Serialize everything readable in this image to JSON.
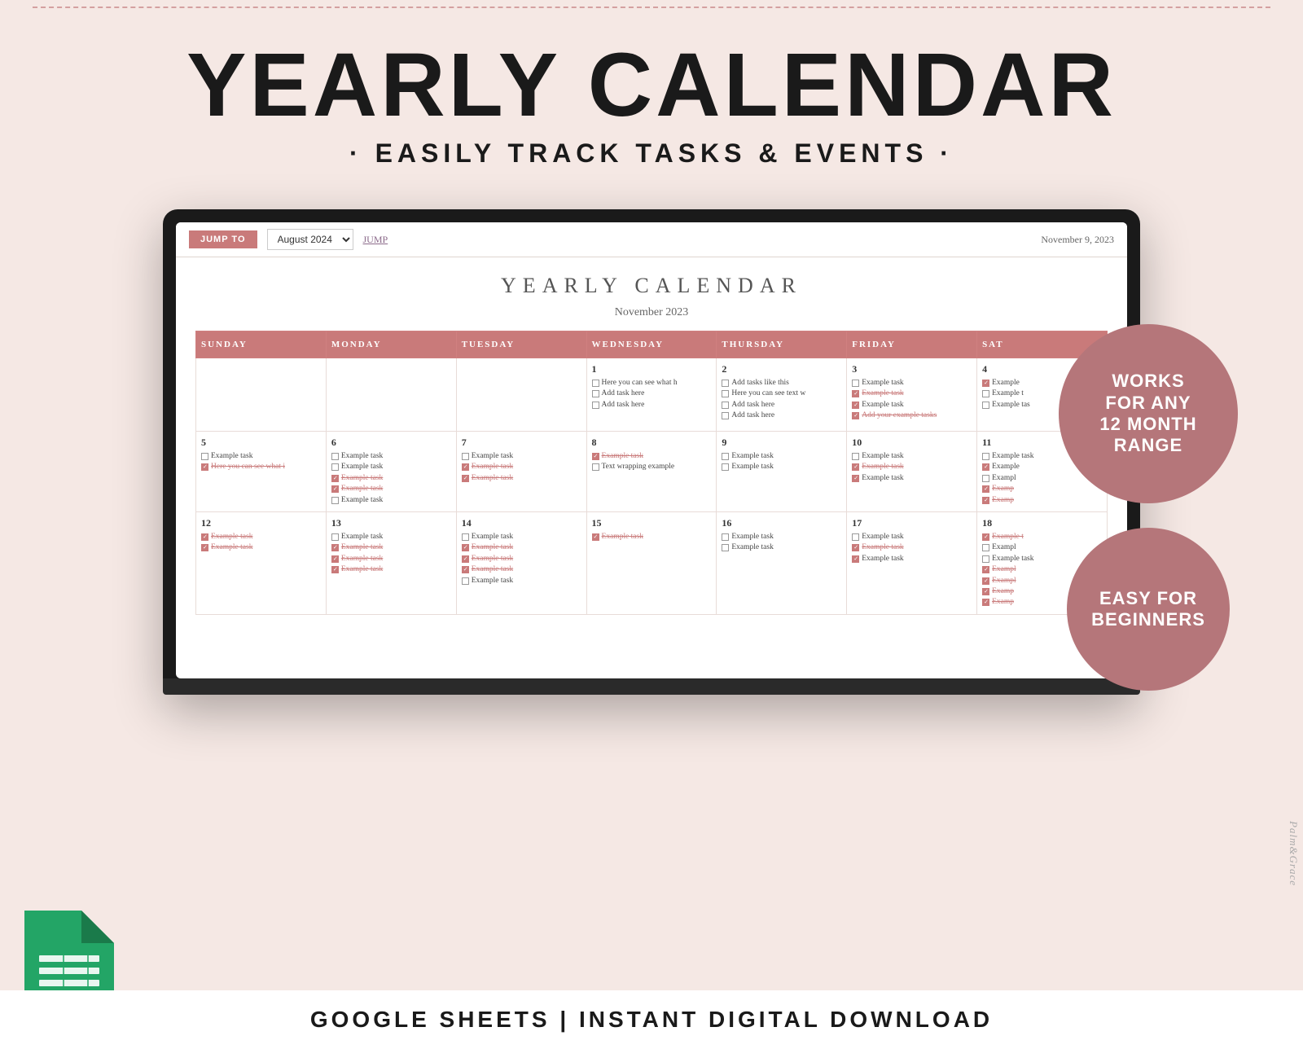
{
  "header": {
    "main_title": "YEARLY CALENDAR",
    "subtitle": "· EASILY TRACK TASKS & EVENTS ·"
  },
  "toolbar": {
    "jump_to_label": "JUMP TO",
    "month_value": "August 2024",
    "jump_link": "JUMP",
    "date_display": "November 9, 2023"
  },
  "calendar": {
    "title": "YEARLY CALENDAR",
    "month": "November 2023",
    "days": [
      "SUNDAY",
      "MONDAY",
      "TUESDAY",
      "WEDNESDAY",
      "THURSDAY",
      "FRIDAY",
      "SAT"
    ],
    "weeks": [
      {
        "cells": [
          {
            "day": "",
            "tasks": [],
            "empty": true
          },
          {
            "day": "",
            "tasks": [],
            "empty": true
          },
          {
            "day": "",
            "tasks": [],
            "empty": true
          },
          {
            "day": "1",
            "tasks": [
              {
                "text": "Here you can see what h",
                "checked": false,
                "strike": false
              },
              {
                "text": "Add task here",
                "checked": false,
                "strike": false
              },
              {
                "text": "Add task here",
                "checked": false,
                "strike": false
              }
            ]
          },
          {
            "day": "2",
            "tasks": [
              {
                "text": "Add tasks like this",
                "checked": false,
                "strike": false
              },
              {
                "text": "Here you can see text w",
                "checked": false,
                "strike": false
              },
              {
                "text": "Add task here",
                "checked": false,
                "strike": false
              },
              {
                "text": "Add task here",
                "checked": false,
                "strike": false
              }
            ]
          },
          {
            "day": "3",
            "tasks": [
              {
                "text": "Example task",
                "checked": false,
                "strike": false
              },
              {
                "text": "Example task",
                "checked": true,
                "strike": true
              },
              {
                "text": "Example task",
                "checked": true,
                "strike": false
              },
              {
                "text": "Add your example tasks",
                "checked": true,
                "strike": true
              }
            ]
          },
          {
            "day": "4",
            "tasks": [
              {
                "text": "Example",
                "checked": true,
                "strike": false
              },
              {
                "text": "Example t",
                "checked": false,
                "strike": false
              },
              {
                "text": "Example tas",
                "checked": false,
                "strike": false
              }
            ]
          }
        ]
      },
      {
        "cells": [
          {
            "day": "5",
            "tasks": [
              {
                "text": "Example task",
                "checked": false,
                "strike": false
              },
              {
                "text": "Here you can see what i",
                "checked": true,
                "strike": true
              }
            ]
          },
          {
            "day": "6",
            "tasks": [
              {
                "text": "Example task",
                "checked": false,
                "strike": false
              },
              {
                "text": "Example task",
                "checked": false,
                "strike": false
              },
              {
                "text": "Example task",
                "checked": true,
                "strike": true
              },
              {
                "text": "Example task",
                "checked": true,
                "strike": true
              },
              {
                "text": "Example task",
                "checked": false,
                "strike": false
              }
            ]
          },
          {
            "day": "7",
            "tasks": [
              {
                "text": "Example task",
                "checked": false,
                "strike": false
              },
              {
                "text": "Example task",
                "checked": true,
                "strike": true
              },
              {
                "text": "Example task",
                "checked": true,
                "strike": true
              }
            ]
          },
          {
            "day": "8",
            "tasks": [
              {
                "text": "Example task",
                "checked": true,
                "strike": true
              },
              {
                "text": "Text wrapping example",
                "checked": false,
                "strike": false
              }
            ]
          },
          {
            "day": "9",
            "tasks": [
              {
                "text": "Example task",
                "checked": false,
                "strike": false
              },
              {
                "text": "Example task",
                "checked": false,
                "strike": false
              }
            ]
          },
          {
            "day": "10",
            "tasks": [
              {
                "text": "Example task",
                "checked": false,
                "strike": false
              },
              {
                "text": "Example task",
                "checked": true,
                "strike": true
              },
              {
                "text": "Example task",
                "checked": true,
                "strike": false
              }
            ]
          },
          {
            "day": "11",
            "tasks": [
              {
                "text": "Example task",
                "checked": false,
                "strike": false
              },
              {
                "text": "Example",
                "checked": true,
                "strike": false
              },
              {
                "text": "Exampl",
                "checked": false,
                "strike": false
              },
              {
                "text": "Examp",
                "checked": true,
                "strike": true
              },
              {
                "text": "Examp",
                "checked": true,
                "strike": true
              }
            ]
          }
        ]
      },
      {
        "cells": [
          {
            "day": "12",
            "tasks": [
              {
                "text": "Example task",
                "checked": true,
                "strike": true
              },
              {
                "text": "Example task",
                "checked": true,
                "strike": true
              }
            ]
          },
          {
            "day": "13",
            "tasks": [
              {
                "text": "Example task",
                "checked": false,
                "strike": false
              },
              {
                "text": "Example task",
                "checked": true,
                "strike": true
              },
              {
                "text": "Example task",
                "checked": true,
                "strike": true
              },
              {
                "text": "Example task",
                "checked": true,
                "strike": true
              }
            ]
          },
          {
            "day": "14",
            "tasks": [
              {
                "text": "Example task",
                "checked": false,
                "strike": false
              },
              {
                "text": "Example task",
                "checked": true,
                "strike": true
              },
              {
                "text": "Example task",
                "checked": true,
                "strike": true
              },
              {
                "text": "Example task",
                "checked": true,
                "strike": true
              },
              {
                "text": "Example task",
                "checked": false,
                "strike": false
              }
            ]
          },
          {
            "day": "15",
            "tasks": [
              {
                "text": "Example task",
                "checked": true,
                "strike": true
              }
            ]
          },
          {
            "day": "16",
            "tasks": [
              {
                "text": "Example task",
                "checked": false,
                "strike": false
              },
              {
                "text": "Example task",
                "checked": false,
                "strike": false
              }
            ]
          },
          {
            "day": "17",
            "tasks": [
              {
                "text": "Example task",
                "checked": false,
                "strike": false
              },
              {
                "text": "Example task",
                "checked": true,
                "strike": true
              },
              {
                "text": "Example task",
                "checked": true,
                "strike": false
              }
            ]
          },
          {
            "day": "18",
            "tasks": [
              {
                "text": "Example t",
                "checked": true,
                "strike": true
              },
              {
                "text": "Exampl",
                "checked": false,
                "strike": false
              },
              {
                "text": "Example task",
                "checked": false,
                "strike": false
              },
              {
                "text": "Exampl",
                "checked": true,
                "strike": true
              },
              {
                "text": "Exampl",
                "checked": true,
                "strike": true
              },
              {
                "text": "Examp",
                "checked": true,
                "strike": true
              },
              {
                "text": "Examp",
                "checked": true,
                "strike": true
              }
            ]
          }
        ]
      }
    ]
  },
  "badges": {
    "works": "WORKS\nFOR ANY\n12 MONTH\nRANGE",
    "easy": "EASY FOR\nBEGINNERS"
  },
  "bottom": {
    "text": "GOOGLE SHEETS | INSTANT DIGITAL DOWNLOAD"
  },
  "watermark": "Palm&Grace"
}
